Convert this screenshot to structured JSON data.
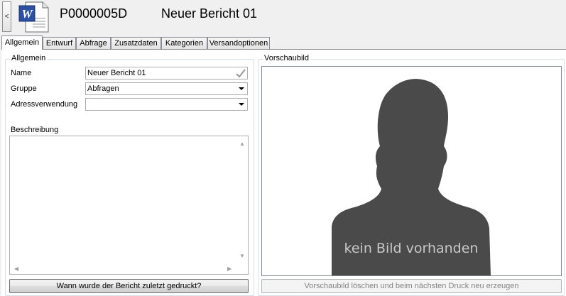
{
  "header": {
    "collapse_glyph": "<",
    "doc_icon": "word-document-icon",
    "doc_icon_letter": "W",
    "number": "P0000005D",
    "title": "Neuer Bericht 01"
  },
  "tabs": [
    {
      "label": "Allgemein",
      "active": true
    },
    {
      "label": "Entwurf"
    },
    {
      "label": "Abfrage"
    },
    {
      "label": "Zusatzdaten"
    },
    {
      "label": "Kategorien"
    },
    {
      "label": "Versandoptionen"
    }
  ],
  "general": {
    "legend": "Allgemein",
    "name_label": "Name",
    "name_value": "Neuer Bericht 01",
    "group_label": "Gruppe",
    "group_value": "Abfragen",
    "address_label": "Adressverwendung",
    "address_value": "",
    "description_label": "Beschreibung",
    "description_value": "",
    "last_printed_button": "Wann wurde der Bericht zuletzt gedruckt?"
  },
  "preview": {
    "legend": "Vorschaubild",
    "placeholder_text": "kein Bild vorhanden",
    "delete_button": "Vorschaubild löschen und beim nächsten Druck neu erzeugen"
  },
  "colors": {
    "silhouette": "#4a4a4a",
    "valid_check": "#999999"
  }
}
